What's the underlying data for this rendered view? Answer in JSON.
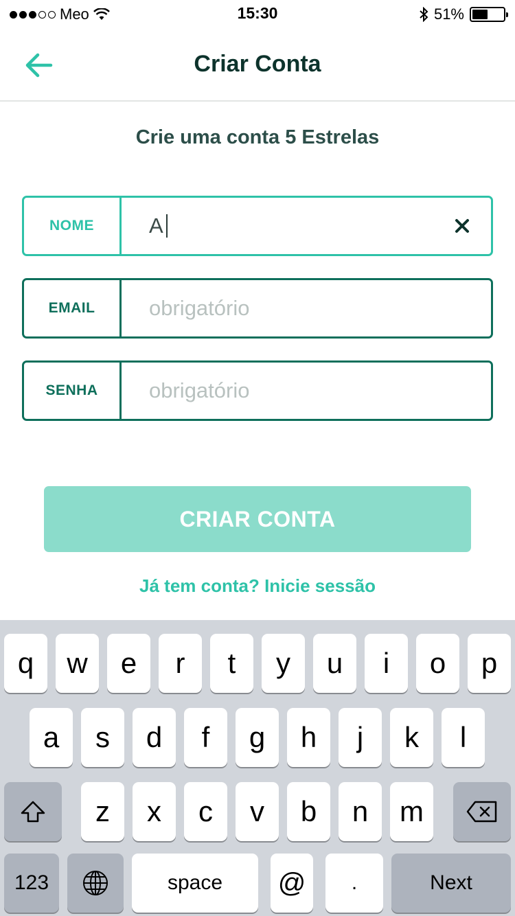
{
  "status_bar": {
    "carrier": "Meo",
    "time": "15:30",
    "battery": "51%",
    "battery_level": 0.51
  },
  "nav": {
    "title": "Criar Conta"
  },
  "subtitle": "Crie uma conta 5 Estrelas",
  "form": {
    "name": {
      "label": "NOME",
      "value": "A"
    },
    "email": {
      "label": "EMAIL",
      "placeholder": "obrigatório",
      "value": ""
    },
    "password": {
      "label": "SENHA",
      "placeholder": "obrigatório",
      "value": ""
    }
  },
  "submit_label": "CRIAR CONTA",
  "signin_link": "Já tem conta? Inicie sessão",
  "colors": {
    "accent": "#2ec2a8",
    "dark_green": "#0e6f5b",
    "button_disabled": "#8bdccb"
  },
  "keyboard": {
    "row1": [
      "q",
      "w",
      "e",
      "r",
      "t",
      "y",
      "u",
      "i",
      "o",
      "p"
    ],
    "row2": [
      "a",
      "s",
      "d",
      "f",
      "g",
      "h",
      "j",
      "k",
      "l"
    ],
    "row3": [
      "z",
      "x",
      "c",
      "v",
      "b",
      "n",
      "m"
    ],
    "numbers": "123",
    "space": "space",
    "at": "@",
    "dot": ".",
    "next": "Next",
    "shift_icon": "shift-arrow-icon",
    "delete_icon": "backspace-icon",
    "globe_icon": "globe-icon"
  }
}
